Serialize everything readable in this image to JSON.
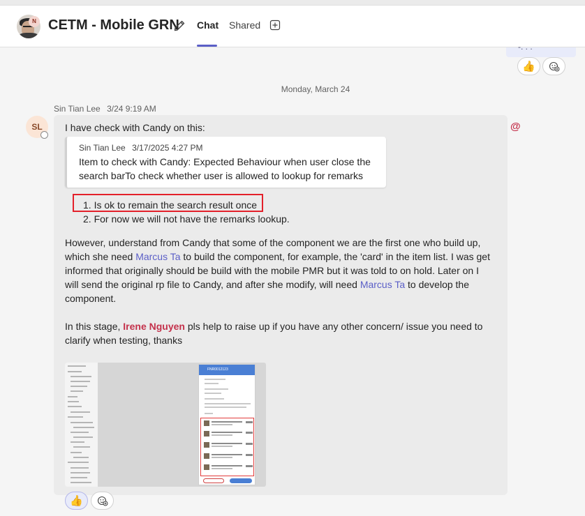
{
  "header": {
    "avatar_badge": "N",
    "title": "CETM - Mobile GRN",
    "tabs": [
      {
        "label": "Chat",
        "active": true
      },
      {
        "label": "Shared",
        "active": false
      }
    ],
    "accent_color": "#5b5fc7"
  },
  "previous_message": {
    "text_fragment": "-. . ."
  },
  "date_divider": "Monday, March 24",
  "message": {
    "sender": "Sin Tian Lee",
    "time": "3/24 9:19 AM",
    "avatar_initials": "SL",
    "intro": "I have check with Candy on this:",
    "quote": {
      "sender": "Sin Tian Lee",
      "time": "3/17/2025 4:27 PM",
      "text": "Item to check with Candy: Expected Behaviour when user close the search barTo check whether user is allowed to lookup for remarks"
    },
    "list": [
      "1. Is ok to remain the search result once",
      "2. For now we will not have the remarks lookup."
    ],
    "para1": {
      "a": "However, understand from Candy that some of the component we are the first one who build up, which she need ",
      "mention1": "Marcus Ta",
      "b": " to build the component, for example, the 'card' in the item list. I was get informed that originally should be build with the mobile PMR but it was told to on hold. Later on I will send the original rp file to Candy, and after she modify, will need ",
      "mention2": "Marcus Ta",
      "c": " to develop the component."
    },
    "para2": {
      "a": "In this stage, ",
      "mention": "Irene Nguyen",
      "b": " pls help to raise up if you have any other concern/ issue you need to clarify when testing, thanks"
    },
    "attachment": {
      "phone_header": "FNR0012123"
    },
    "mention_indicator": "@"
  },
  "icons": [
    "edit-icon",
    "add-tab-icon",
    "thumbs-up-icon",
    "add-reaction-icon",
    "at-mention-icon"
  ]
}
